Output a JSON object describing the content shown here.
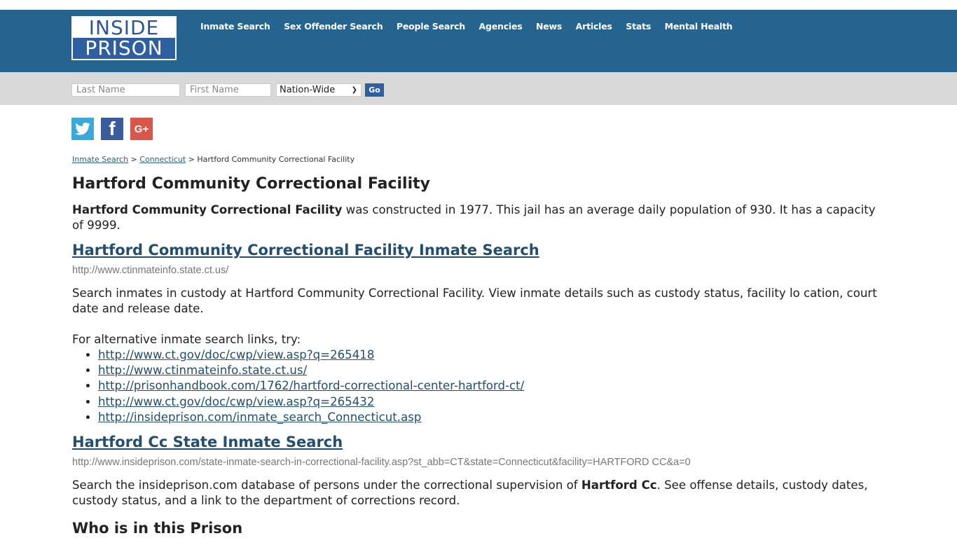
{
  "header": {
    "logo_top": "INSIDE",
    "logo_bottom": "PRISON",
    "nav": [
      "Inmate Search",
      "Sex Offender Search",
      "People Search",
      "Agencies",
      "News",
      "Articles",
      "Stats",
      "Mental Health"
    ]
  },
  "search": {
    "last_placeholder": "Last Name",
    "first_placeholder": "First Name",
    "scope_value": "Nation-Wide",
    "go_label": "Go"
  },
  "social": {
    "twitter_icon": "twitter-icon",
    "facebook_icon": "facebook-icon",
    "google_plus_icon": "google-plus-icon",
    "colors": {
      "twitter": "#3aa9da",
      "facebook": "#3b5b9c",
      "google_plus": "#d9574a"
    }
  },
  "breadcrumb": {
    "items": [
      "Inmate Search",
      "Connecticut"
    ],
    "separator": ">",
    "current": "Hartford Community Correctional Facility"
  },
  "page": {
    "title": "Hartford Community Correctional Facility",
    "intro_bold": "Hartford Community Correctional Facility",
    "intro_rest": " was constructed in 1977. This jail has an average daily population of 930. It has a capacity of 9999."
  },
  "sections": [
    {
      "heading": "Hartford Community Correctional Facility Inmate Search",
      "url": "http://www.ctinmateinfo.state.ct.us/",
      "description": "Search inmates in custody at Hartford Community Correctional Facility. View inmate details such as custody status, facility lo cation, court date and release date.",
      "alt_intro": "For alternative inmate search links, try:",
      "alt_links": [
        "http://www.ct.gov/doc/cwp/view.asp?q=265418",
        "http://www.ctinmateinfo.state.ct.us/",
        "http://prisonhandbook.com/1762/hartford-correctional-center-hartford-ct/",
        "http://www.ct.gov/doc/cwp/view.asp?q=265432",
        "http://insideprison.com/inmate_search_Connecticut.asp"
      ]
    },
    {
      "heading": "Hartford Cc State Inmate Search",
      "url": "http://www.insideprison.com/state-inmate-search-in-correctional-facility.asp?st_abb=CT&state=Connecticut&facility=HARTFORD CC&a=0",
      "desc_pre": "Search the insideprison.com database of persons under the correctional supervision of ",
      "desc_bold": "Hartford Cc",
      "desc_post": ". See offense details, custody dates, custody status, and a link to the department of corrections record."
    }
  ],
  "next_heading": "Who is in this Prison"
}
